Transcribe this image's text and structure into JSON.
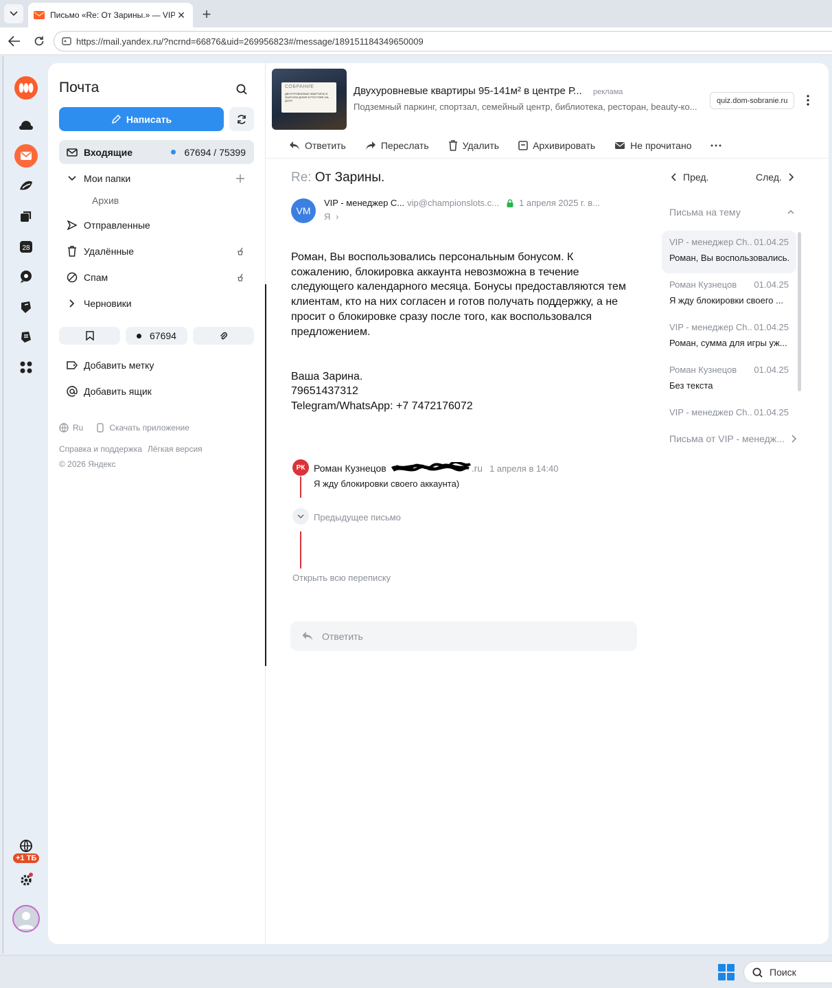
{
  "browser": {
    "tab_title": "Письмо «Re: От Зарины.» — VIP",
    "url": "https://mail.yandex.ru/?ncrnd=66876&uid=269956823#/message/189151184349650009"
  },
  "sidebar": {
    "title": "Почта",
    "compose_label": "Написать",
    "folders": {
      "inbox": {
        "label": "Входящие",
        "count": "67694 / 75399"
      },
      "my_folders": {
        "label": "Мои папки"
      },
      "archive": {
        "label": "Архив"
      },
      "sent": {
        "label": "Отправленные"
      },
      "deleted": {
        "label": "Удалённые"
      },
      "spam": {
        "label": "Спам"
      },
      "drafts": {
        "label": "Черновики"
      }
    },
    "unread_chip": "67694",
    "add_label": "Добавить метку",
    "add_mailbox": "Добавить ящик",
    "footer": {
      "lang": "Ru",
      "download_app": "Скачать приложение",
      "help": "Справка и поддержка",
      "lite": "Лёгкая версия",
      "copyright": "© 2026 Яндекс"
    },
    "rail_badge": "+1 ТБ",
    "rail_calendar_day": "28"
  },
  "ad": {
    "title": "Двухуровневые квартиры 95-141м² в центре Р...",
    "label": "реклама",
    "description": "Подземный паркинг, спортзал, семейный центр, библиотека, ресторан, beauty-ко...",
    "domain": "quiz.dom-sobranie.ru",
    "card_title": "СОБРАНИЕ",
    "card_text": "ДВУХУРОВНЕВЫЕ КВАРТИРЫ В ЗНАТНОМ ДОМЕ В РОСТОВЕ-НА-ДОНУ"
  },
  "actions": {
    "reply": "Ответить",
    "forward": "Переслать",
    "delete": "Удалить",
    "archive": "Архивировать",
    "unread": "Не прочитано"
  },
  "message": {
    "subject_prefix": "Re:",
    "subject": "От Зарины.",
    "sender_initials": "VM",
    "sender_name": "VIP - менеджер С...",
    "sender_email": "vip@championslots.c...",
    "date": "1 апреля 2025 г. в...",
    "recipient": "Я",
    "body_paragraph": "Роман, Вы воспользовались персональным бонусом. К сожалению, блокировка аккаунта невозможна в течение следующего календарного месяца. Бонусы предоставляются тем клиентам, кто на них согласен и готов получать поддержку, а не просит о блокировке сразу после того, как воспользовался предложением.",
    "signature_name": "Ваша Зарина.",
    "signature_phone": "79651437312",
    "signature_messengers": "Telegram/WhatsApp: +7 7472176072"
  },
  "quoted": {
    "initials": "РК",
    "name": "Роман Кузнецов",
    "email_tail": ".ru",
    "date": "1 апреля в 14:40",
    "text": "Я жду блокировки своего аккаунта)",
    "previous_label": "Предыдущее письмо",
    "open_all": "Открыть всю переписку"
  },
  "reply_box": {
    "label": "Ответить"
  },
  "thread": {
    "prev": "Пред.",
    "next": "След.",
    "header": "Письма на тему",
    "items": [
      {
        "from": "VIP - менеджер Ch...",
        "date": "01.04.25",
        "preview": "Роман, Вы воспользовались..."
      },
      {
        "from": "Роман Кузнецов",
        "date": "01.04.25",
        "preview": "Я жду блокировки своего ..."
      },
      {
        "from": "VIP - менеджер Ch...",
        "date": "01.04.25",
        "preview": "Роман, сумма для игры уж..."
      },
      {
        "from": "Роман Кузнецов",
        "date": "01.04.25",
        "preview": "Без текста"
      },
      {
        "from": "VIP - менеджер Ch...",
        "date": "01.04.25",
        "preview": ""
      }
    ],
    "from_link": "Письма от VIP - менедж..."
  },
  "taskbar": {
    "search": "Поиск"
  },
  "colors": {
    "accent": "#2e8ef0",
    "brand": "#fc5d29",
    "quote": "#d8343a"
  }
}
